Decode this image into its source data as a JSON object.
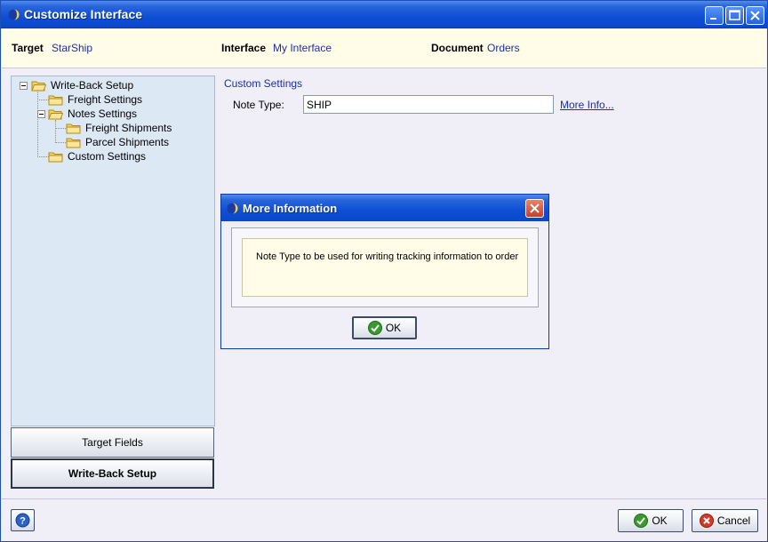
{
  "window": {
    "title": "Customize Interface"
  },
  "header": {
    "target_label": "Target",
    "target_value": "StarShip",
    "interface_label": "Interface",
    "interface_value": "My Interface",
    "document_label": "Document",
    "document_value": "Orders"
  },
  "tree": {
    "items": [
      {
        "label": "Write-Back Setup",
        "icon": "folder-open-icon"
      },
      {
        "label": "Freight Settings",
        "icon": "folder-icon"
      },
      {
        "label": "Notes Settings",
        "icon": "folder-open-icon"
      },
      {
        "label": "Freight Shipments",
        "icon": "folder-icon"
      },
      {
        "label": "Parcel Shipments",
        "icon": "folder-icon"
      },
      {
        "label": "Custom Settings",
        "icon": "folder-icon"
      }
    ]
  },
  "nav": {
    "target_fields": "Target Fields",
    "write_back_setup": "Write-Back Setup"
  },
  "main": {
    "section_title": "Custom Settings",
    "note_type_label": "Note Type:",
    "note_type_value": "SHIP",
    "more_info_link": "More Info..."
  },
  "dialog": {
    "title": "More Information",
    "message": "Note Type to be used for writing tracking information to order",
    "ok_label": "OK"
  },
  "footer": {
    "ok_label": "OK",
    "cancel_label": "Cancel"
  },
  "colors": {
    "titlebar": "#0d4fd6",
    "header_bg": "#fffde8",
    "tree_bg": "#dde8f5",
    "link": "#1c2fa8"
  }
}
